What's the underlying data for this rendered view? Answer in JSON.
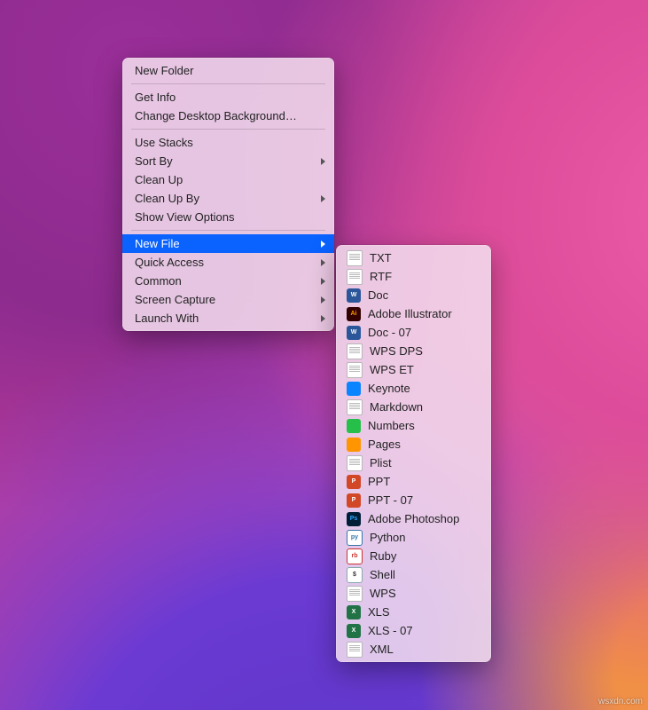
{
  "context_menu": {
    "groups": [
      [
        {
          "label": "New Folder",
          "submenu": false
        }
      ],
      [
        {
          "label": "Get Info",
          "submenu": false
        },
        {
          "label": "Change Desktop Background…",
          "submenu": false
        }
      ],
      [
        {
          "label": "Use Stacks",
          "submenu": false
        },
        {
          "label": "Sort By",
          "submenu": true
        },
        {
          "label": "Clean Up",
          "submenu": false
        },
        {
          "label": "Clean Up By",
          "submenu": true
        },
        {
          "label": "Show View Options",
          "submenu": false
        }
      ],
      [
        {
          "label": "New File",
          "submenu": true,
          "highlighted": true
        },
        {
          "label": "Quick Access",
          "submenu": true
        },
        {
          "label": "Common",
          "submenu": true
        },
        {
          "label": "Screen Capture",
          "submenu": true
        },
        {
          "label": "Launch With",
          "submenu": true
        }
      ]
    ]
  },
  "new_file_submenu": {
    "items": [
      {
        "label": "TXT",
        "icon": "doc-page"
      },
      {
        "label": "RTF",
        "icon": "doc-page"
      },
      {
        "label": "Doc",
        "icon": "box w",
        "badge": "W"
      },
      {
        "label": "Adobe Illustrator",
        "icon": "box ai",
        "badge": "Ai"
      },
      {
        "label": "Doc - 07",
        "icon": "box w",
        "badge": "W"
      },
      {
        "label": "WPS DPS",
        "icon": "doc-page"
      },
      {
        "label": "WPS ET",
        "icon": "doc-page"
      },
      {
        "label": "Keynote",
        "icon": "box kn",
        "badge": ""
      },
      {
        "label": "Markdown",
        "icon": "doc-page"
      },
      {
        "label": "Numbers",
        "icon": "box nm",
        "badge": ""
      },
      {
        "label": "Pages",
        "icon": "box pg",
        "badge": ""
      },
      {
        "label": "Plist",
        "icon": "doc-page"
      },
      {
        "label": "PPT",
        "icon": "box p",
        "badge": "P"
      },
      {
        "label": "PPT - 07",
        "icon": "box p",
        "badge": "P"
      },
      {
        "label": "Adobe Photoshop",
        "icon": "box ps",
        "badge": "Ps"
      },
      {
        "label": "Python",
        "icon": "box py",
        "badge": "py"
      },
      {
        "label": "Ruby",
        "icon": "box rb",
        "badge": "rb"
      },
      {
        "label": "Shell",
        "icon": "box sh",
        "badge": "$"
      },
      {
        "label": "WPS",
        "icon": "doc-page"
      },
      {
        "label": "XLS",
        "icon": "box x",
        "badge": "X"
      },
      {
        "label": "XLS - 07",
        "icon": "box x",
        "badge": "X"
      },
      {
        "label": "XML",
        "icon": "doc-page"
      }
    ]
  },
  "watermark": "wsxdn.com"
}
